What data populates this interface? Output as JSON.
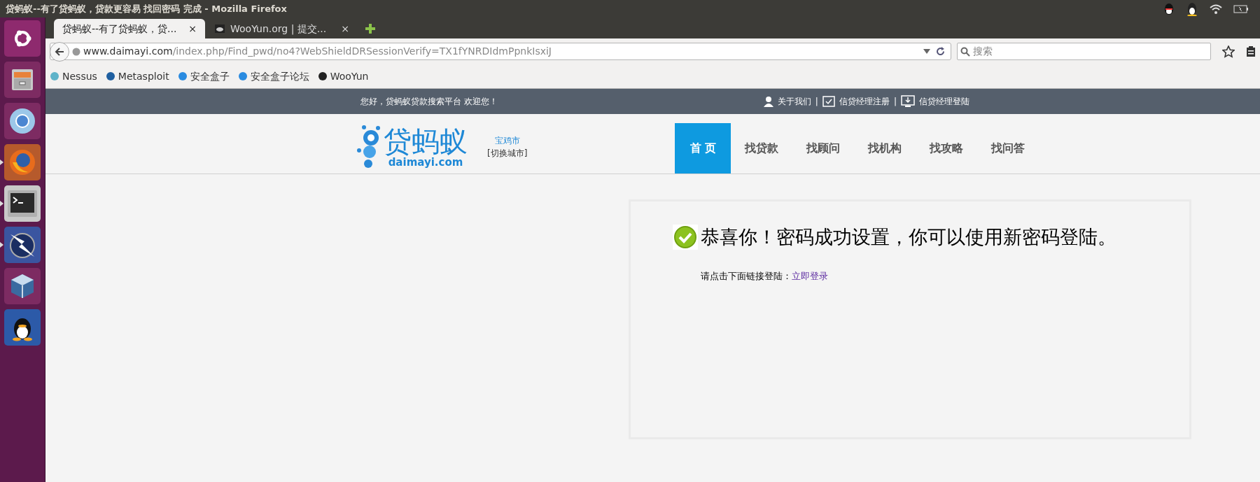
{
  "window": {
    "title": "贷蚂蚁--有了贷蚂蚁，贷款更容易 找回密码 完成 - Mozilla Firefox"
  },
  "launcher": {
    "items": [
      {
        "kind": "ubuntu",
        "running": false
      },
      {
        "kind": "files",
        "running": false
      },
      {
        "kind": "chromium",
        "running": false
      },
      {
        "kind": "firefox",
        "running": true
      },
      {
        "kind": "terminal",
        "running": true
      },
      {
        "kind": "zap",
        "running": true
      },
      {
        "kind": "virtualbox",
        "running": false
      },
      {
        "kind": "qq",
        "running": false
      }
    ]
  },
  "tabs": [
    {
      "label": "贷蚂蚁--有了贷蚂蚁，贷...",
      "selected": true,
      "close": "×"
    },
    {
      "label": "WooYun.org | 提交...",
      "selected": false,
      "close": "×"
    }
  ],
  "address_bar": {
    "host": "www.daimayi.com",
    "path": "/index.php/Find_pwd/no4?WebShieldDRSessionVerify=TX1fYNRDIdmPpnkIsxiJ"
  },
  "search": {
    "placeholder": "搜索"
  },
  "bookmarks": [
    "Nessus",
    "Metasploit",
    "安全盒子",
    "安全盒子论坛",
    "WooYun"
  ],
  "page": {
    "top_bar": {
      "greeting": "您好，贷蚂蚁贷款搜索平台 欢迎您！",
      "links": [
        "关于我们",
        "信贷经理注册",
        "信贷经理登陆"
      ],
      "separator": "|"
    },
    "logo": {
      "name": "贷蚂蚁",
      "domain": "daimayi.com"
    },
    "city": {
      "name": "宝鸡市",
      "switch": "[切换城市]"
    },
    "nav": [
      {
        "label": "首 页",
        "selected": true
      },
      {
        "label": "找贷款",
        "selected": false
      },
      {
        "label": "找顾问",
        "selected": false
      },
      {
        "label": "找机构",
        "selected": false
      },
      {
        "label": "找攻略",
        "selected": false
      },
      {
        "label": "找问答",
        "selected": false
      }
    ],
    "message": {
      "title": "恭喜你！密码成功设置，你可以使用新密码登陆。",
      "hint": "请点击下面链接登陆：",
      "link": "立即登录"
    }
  }
}
